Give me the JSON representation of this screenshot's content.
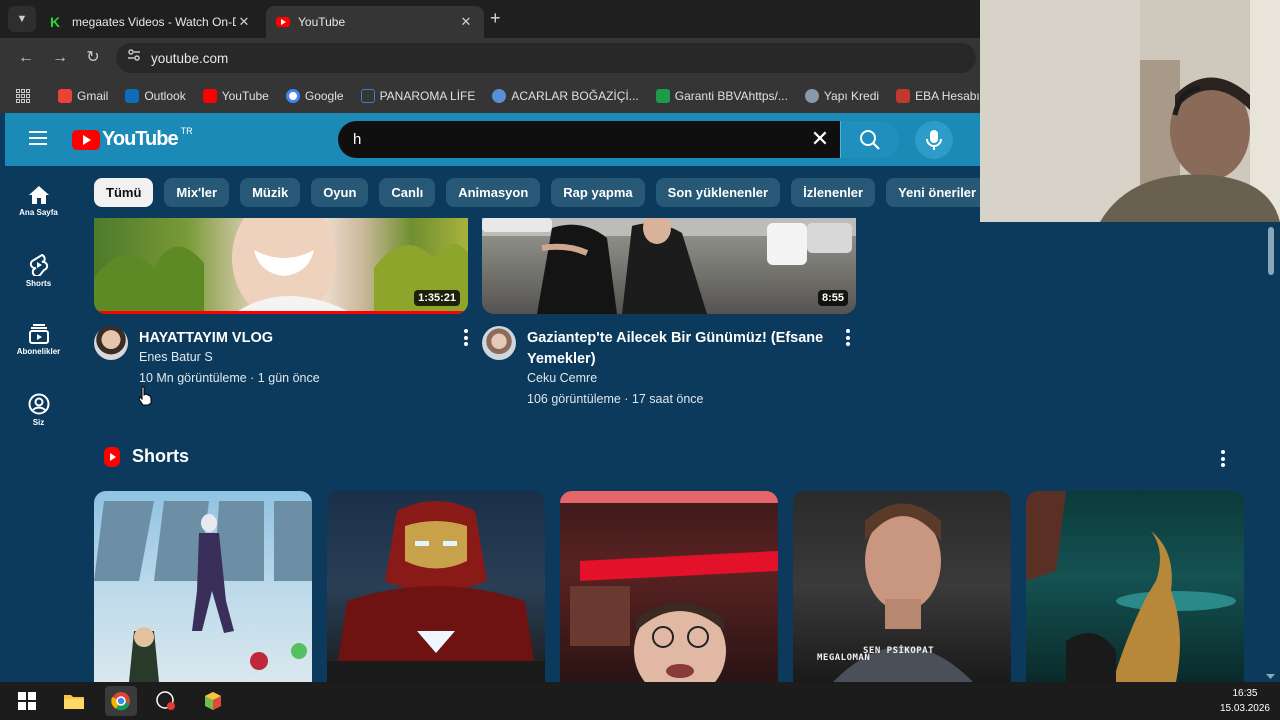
{
  "browser": {
    "tabs": [
      {
        "title": "megaates Videos - Watch On-D",
        "favicon": "kick-icon",
        "active": false
      },
      {
        "title": "YouTube",
        "favicon": "youtube-icon",
        "active": true
      }
    ],
    "url": "youtube.com",
    "bookmarks": [
      {
        "label": "Gmail",
        "color": "#ea4335"
      },
      {
        "label": "Outlook",
        "color": "#0f6cbd"
      },
      {
        "label": "YouTube",
        "color": "#ff0000"
      },
      {
        "label": "Google",
        "color": "#4285f4"
      },
      {
        "label": "PANAROMA LİFE",
        "color": "#3a7bd5"
      },
      {
        "label": "ACARLAR BOĞAZİÇİ...",
        "color": "#5a8fd8"
      },
      {
        "label": "Garanti BBVAhttps/...",
        "color": "#1f9a4a"
      },
      {
        "label": "Yapı Kredi",
        "color": "#9ab"
      },
      {
        "label": "EBA Hesabı ile Giriş...",
        "color": "#c0392b"
      }
    ]
  },
  "youtube": {
    "logo_text": "YouTube",
    "logo_region": "TR",
    "search_value": "h",
    "nav": [
      {
        "label": "Ana Sayfa",
        "icon": "home-icon"
      },
      {
        "label": "Shorts",
        "icon": "shorts-icon"
      },
      {
        "label": "Abonelikler",
        "icon": "subscriptions-icon"
      },
      {
        "label": "Siz",
        "icon": "you-icon"
      }
    ],
    "chips": [
      "Tümü",
      "Mix'ler",
      "Müzik",
      "Oyun",
      "Canlı",
      "Animasyon",
      "Rap yapma",
      "Son yüklenenler",
      "İzlenenler",
      "Yeni öneriler"
    ],
    "selected_chip": "Tümü",
    "videos": [
      {
        "title": "HAYATTAYIM VLOG",
        "channel": "Enes Batur S",
        "stats": "10 Mn görüntüleme · 1 gün önce",
        "duration": "1:35:21",
        "watched_fraction": 1.0
      },
      {
        "title": "Gaziantep'te Ailecek Bir Günümüz! (Efsane Yemekler)",
        "channel": "Ceku Cemre",
        "stats": "106 görüntüleme · 17 saat önce",
        "duration": "8:55",
        "watched_fraction": 0
      }
    ],
    "shorts_title": "Shorts",
    "shorts_captions": [
      "MEGALOMAN",
      "SEN PSİKOPAT"
    ]
  },
  "taskbar": {
    "time": "16:35",
    "date": "15.03.2026"
  }
}
